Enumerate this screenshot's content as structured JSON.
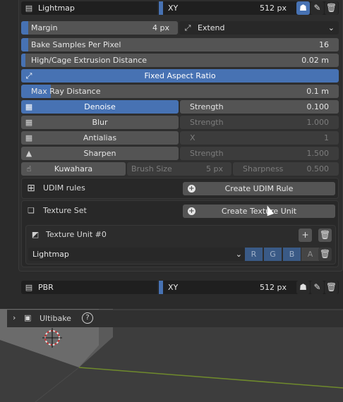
{
  "bake_target_top": {
    "name": "Lightmap",
    "mode": "XY",
    "size": "512 px"
  },
  "margin": {
    "label": "Margin",
    "value": "4 px",
    "mode": "Extend"
  },
  "bake_samples": {
    "label": "Bake Samples Per Pixel",
    "value": "16"
  },
  "extrusion": {
    "label": "High/Cage Extrusion Distance",
    "value": "0.02 m"
  },
  "fixed_aspect": {
    "label": "Fixed Aspect Ratio"
  },
  "max_ray": {
    "label": "Max Ray Distance",
    "value": "0.1 m"
  },
  "filters": [
    {
      "name": "Denoise",
      "param": "Strength",
      "value": "0.100",
      "active": true
    },
    {
      "name": "Blur",
      "param": "Strength",
      "value": "1.000",
      "active": false
    },
    {
      "name": "Antialias",
      "param": "X",
      "value": "1",
      "active": false
    },
    {
      "name": "Sharpen",
      "param": "Strength",
      "value": "1.500",
      "active": false
    }
  ],
  "kuwahara": {
    "name": "Kuwahara",
    "brush_label": "Brush Size",
    "brush_value": "5 px",
    "sharp_label": "Sharpness",
    "sharp_value": "0.500"
  },
  "udim": {
    "label": "UDIM rules",
    "button": "Create UDIM Rule"
  },
  "texture_set": {
    "label": "Texture Set",
    "button": "Create Texture Unit"
  },
  "texture_unit": {
    "label": "Texture Unit #0",
    "map": "Lightmap",
    "channels": [
      "R",
      "G",
      "B",
      "A"
    ]
  },
  "bake_target_bottom": {
    "name": "PBR",
    "mode": "XY",
    "size": "512 px"
  },
  "ultibake": {
    "label": "Ultibake",
    "help": "?"
  }
}
